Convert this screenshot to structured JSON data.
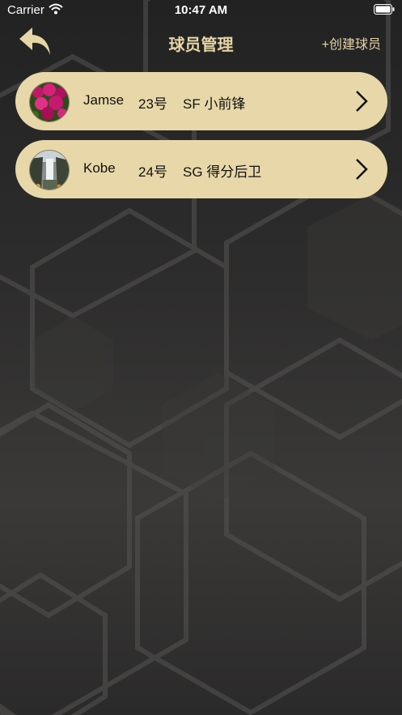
{
  "status_bar": {
    "carrier": "Carrier",
    "time": "10:47 AM",
    "wifi_icon": "wifi-icon",
    "battery_icon": "battery-icon"
  },
  "nav": {
    "title": "球员管理",
    "create_label": "+创建球员",
    "back_icon": "back-arrow-icon"
  },
  "players": [
    {
      "name": "Jamse",
      "number": "23号",
      "position": "SF 小前锋",
      "avatar": "flowers-photo"
    },
    {
      "name": "Kobe",
      "number": "24号",
      "position": "SG 得分后卫",
      "avatar": "waterfall-photo"
    }
  ],
  "colors": {
    "accent": "#e6d5a6",
    "card_background": "#e8d8a9",
    "background": "#2e2d2d"
  }
}
